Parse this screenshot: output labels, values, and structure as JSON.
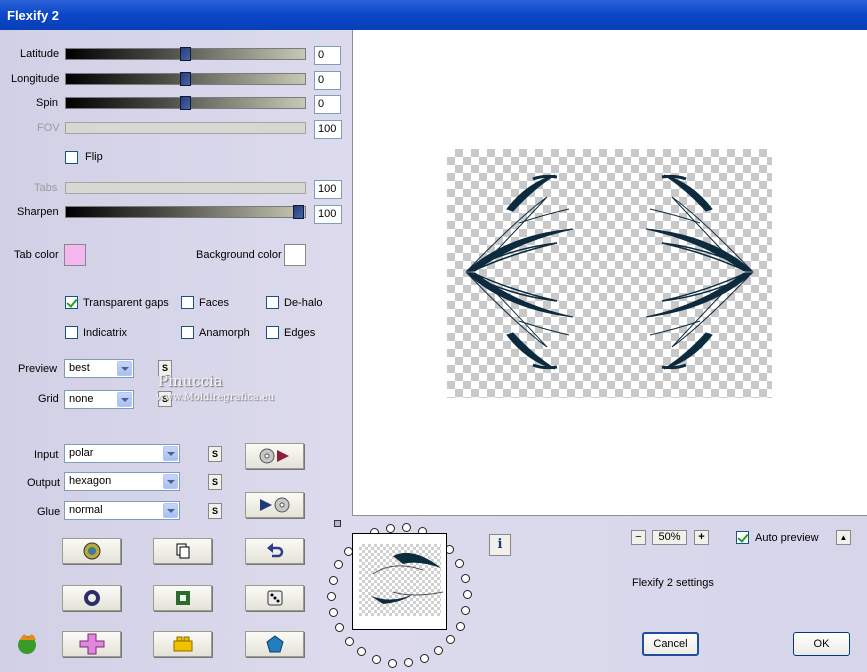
{
  "window": {
    "title": "Flexify 2"
  },
  "sliders": [
    {
      "label": "Latitude",
      "value": "0",
      "level": 0.5,
      "enabled": true
    },
    {
      "label": "Longitude",
      "value": "0",
      "level": 0.5,
      "enabled": true
    },
    {
      "label": "Spin",
      "value": "0",
      "level": 0.5,
      "enabled": true
    },
    {
      "label": "FOV",
      "value": "100",
      "enabled": false
    },
    {
      "label": "Tabs",
      "value": "100",
      "enabled": false
    },
    {
      "label": "Sharpen",
      "value": "100",
      "level": 1.0,
      "enabled": true
    }
  ],
  "flip": {
    "label": "Flip",
    "checked": false
  },
  "colors": {
    "tab_label": "Tab color",
    "tab_value": "#f4b8f0",
    "bg_label": "Background color",
    "bg_value": "#ffffff"
  },
  "options": {
    "transparent_gaps": {
      "label": "Transparent gaps",
      "checked": true
    },
    "faces": {
      "label": "Faces",
      "checked": false
    },
    "de_halo": {
      "label": "De-halo",
      "checked": false
    },
    "indicatrix": {
      "label": "Indicatrix",
      "checked": false
    },
    "anamorph": {
      "label": "Anamorph",
      "checked": false
    },
    "edges": {
      "label": "Edges",
      "checked": false
    }
  },
  "preview_select": {
    "label": "Preview",
    "value": "best"
  },
  "grid_select": {
    "label": "Grid",
    "value": "none"
  },
  "input_select": {
    "label": "Input",
    "value": "polar"
  },
  "output_select": {
    "label": "Output",
    "value": "hexagon"
  },
  "glue_select": {
    "label": "Glue",
    "value": "normal"
  },
  "small_button_label": "S",
  "watermark": {
    "name": "Pinuccia",
    "site": "www.Moldiregrafica.eu"
  },
  "zoom": {
    "minus": "−",
    "value": "50%",
    "plus": "+"
  },
  "auto_preview": {
    "label": "Auto preview",
    "checked": true
  },
  "settings_caption": "Flexify 2 settings",
  "info_label": "i",
  "collapse_label": "▲",
  "buttons": {
    "cancel": "Cancel",
    "ok": "OK"
  },
  "accent": {
    "titlebar": "#0a46c9",
    "slider_thumb": "#2a3d76",
    "shape_color": "#0d2b3e"
  }
}
